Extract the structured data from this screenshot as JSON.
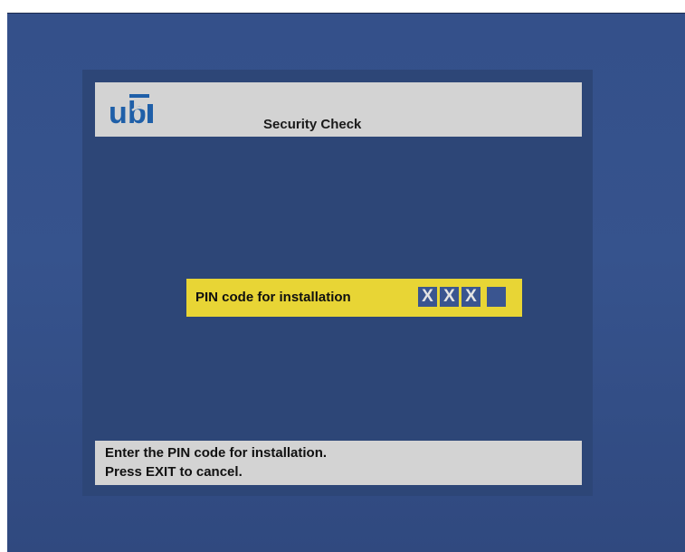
{
  "header": {
    "logo_text": "ubi",
    "title": "Security Check"
  },
  "pin_prompt": {
    "label": "PIN code for installation",
    "digits": [
      "X",
      "X",
      "X",
      ""
    ]
  },
  "footer": {
    "line1": "Enter the PIN code for installation.",
    "line2": "Press EXIT to cancel."
  },
  "colors": {
    "background": "#34508a",
    "panel": "#2d4677",
    "bar": "#d3d3d3",
    "highlight": "#e8d535",
    "digit_box": "#3a5590",
    "brand": "#1f5fa8"
  }
}
